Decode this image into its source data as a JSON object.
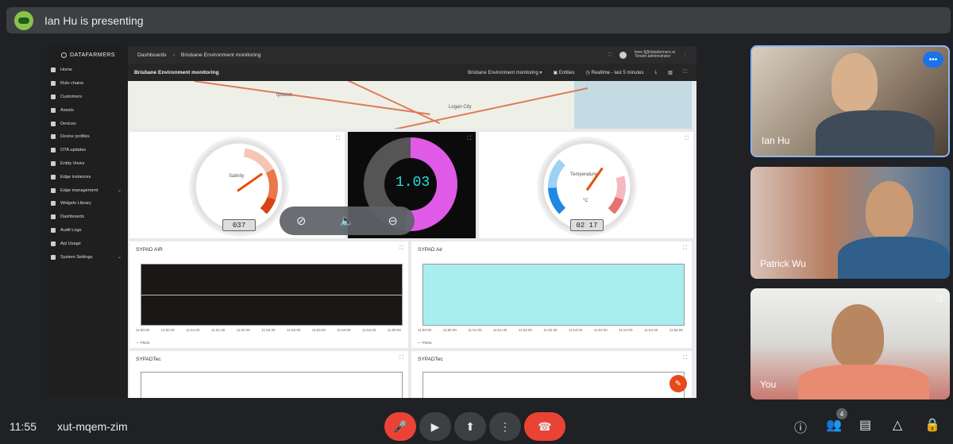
{
  "presenter": {
    "text": "Ian Hu is presenting"
  },
  "app": {
    "logo": "DATAFARMERS",
    "breadcrumb": [
      "Dashboards",
      "Brisbane Environment monitoring"
    ],
    "user_line1": "bree.fj@datafarmers.ai",
    "user_line2": "Tenant administrator",
    "page_title": "Brisbane Environment monitoring",
    "dashboard_select": "Brisbane Environment monitoring",
    "entities": "Entities",
    "realtime": "Realtime - last 5 minutes"
  },
  "sidebar": {
    "items": [
      {
        "label": "Home"
      },
      {
        "label": "Rule chains"
      },
      {
        "label": "Customers"
      },
      {
        "label": "Assets"
      },
      {
        "label": "Devices"
      },
      {
        "label": "Device profiles"
      },
      {
        "label": "OTA updates"
      },
      {
        "label": "Entity Views"
      },
      {
        "label": "Edge instances"
      },
      {
        "label": "Edge management"
      },
      {
        "label": "Widgets Library"
      },
      {
        "label": "Dashboards"
      },
      {
        "label": "Audit Logs"
      },
      {
        "label": "Api Usage"
      },
      {
        "label": "System Settings"
      }
    ]
  },
  "map": {
    "labels": [
      "Ipswich",
      "Logan City"
    ]
  },
  "gauges": {
    "salinity": {
      "label": "Salinity",
      "value_text": "037",
      "value": 37,
      "min": -100,
      "max": 100
    },
    "digital": {
      "value_text": "1.03",
      "value": 1.03
    },
    "temperature": {
      "label": "Temperature",
      "unit": "°C",
      "value_text": "02 17",
      "value": 17,
      "min": -60,
      "max": 60
    }
  },
  "timeseries": {
    "air1": {
      "title": "SYPAD AIR",
      "legend": "PM25"
    },
    "air2": {
      "title": "SYPAD Air",
      "legend": "PM25"
    },
    "tec1": {
      "title": "SYPADTec"
    },
    "tec2": {
      "title": "SYPADTec"
    },
    "xticks": [
      "11:50:00",
      "11:50:30",
      "11:51:00",
      "11:51:30",
      "11:52:00",
      "11:52:30",
      "11:53:00",
      "11:53:30",
      "11:54:00",
      "11:54:30",
      "11:55:00"
    ]
  },
  "participants": [
    {
      "name": "Ian Hu"
    },
    {
      "name": "Patrick Wu"
    },
    {
      "name": "You"
    }
  ],
  "meeting": {
    "time": "11:55",
    "code": "xut-mqem-zim",
    "people_count": "4"
  },
  "colors": {
    "end_call": "#ea4335",
    "accent": "#1a73e8",
    "gauge_pink": "#e05ae8",
    "digital_text": "#27e0d5"
  }
}
